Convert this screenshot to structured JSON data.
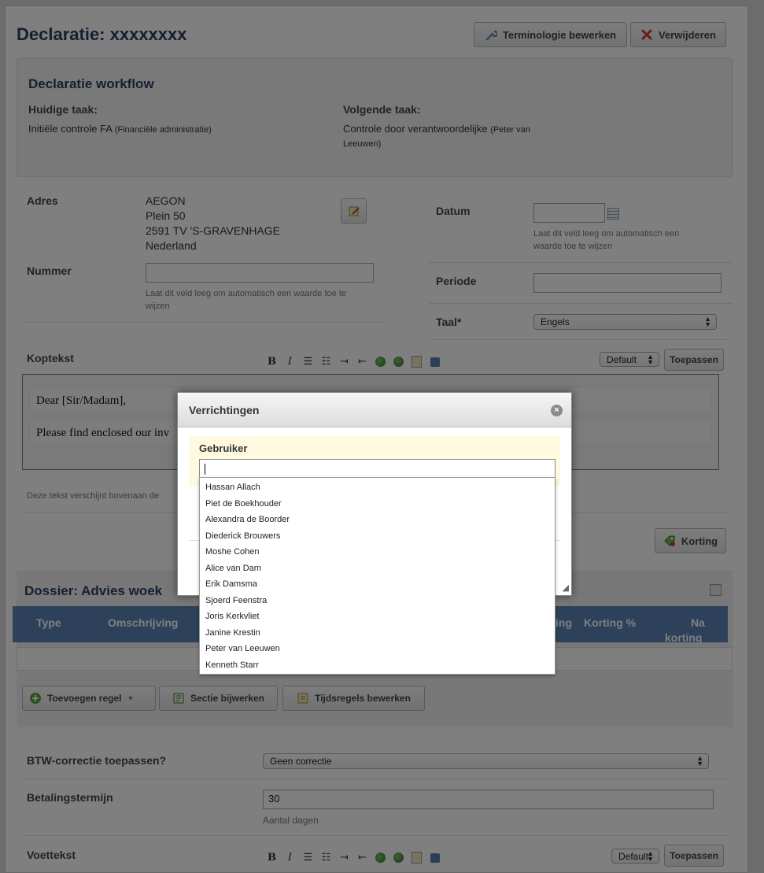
{
  "header": {
    "title": "Declaratie: xxxxxxxx",
    "terminology_button": "Terminologie bewerken",
    "delete_button": "Verwijderen"
  },
  "workflow": {
    "title": "Declaratie workflow",
    "current_task_label": "Huidige taak:",
    "current_task_value": "Initiële controle FA",
    "current_task_note": "(Financiële administratie)",
    "next_task_label": "Volgende taak:",
    "next_task_value": "Controle door verantwoordelijke",
    "next_task_note_line1": "(Peter van",
    "next_task_note_line2": "Leeuwen)"
  },
  "form": {
    "address_label": "Adres",
    "address_lines": [
      "AEGON",
      "Plein 50",
      "2591 TV 'S-GRAVENHAGE",
      "Nederland"
    ],
    "number_label": "Nummer",
    "number_value": "",
    "number_hint_line1": "Laat dit veld leeg om automatisch een waarde toe te",
    "number_hint_line2": "wijzen",
    "date_label": "Datum",
    "date_value": "",
    "date_hint_line1": "Laat dit veld leeg om automatisch een",
    "date_hint_line2": "waarde toe te wijzen",
    "period_label": "Periode",
    "period_value": "",
    "language_label": "Taal*",
    "language_value": "Engels"
  },
  "header_text": {
    "label": "Koptekst",
    "style_select": "Default",
    "apply_button": "Toepassen",
    "line1": "Dear [Sir/Madam],",
    "line2": "Please find enclosed our inv",
    "hint": "Deze tekst verschijnt bovenaan de"
  },
  "discount_button": "Korting",
  "dossier": {
    "title": "Dossier: Advies woek",
    "columns": [
      "Type",
      "Omschrijving",
      "ing",
      "Korting %",
      "Na",
      "korting"
    ],
    "add_row_button": "Toevoegen regel",
    "section_edit_button": "Sectie bijwerken",
    "time_rows_button": "Tijdsregels bewerken"
  },
  "vat": {
    "label": "BTW-correctie toepassen?",
    "value": "Geen correctie"
  },
  "payment": {
    "label": "Betalingstermijn",
    "value": "30",
    "hint": "Aantal dagen"
  },
  "footer_text": {
    "label": "Voettekst",
    "style_select": "Default",
    "apply_button": "Toepassen"
  },
  "modal": {
    "title": "Verrichtingen",
    "field_label": "Gebruiker",
    "field_value": "",
    "options": [
      "Hassan Allach",
      "Piet de Boekhouder",
      "Alexandra de Boorder",
      "Diederick Brouwers",
      "Moshe Cohen",
      "Alice van Dam",
      "Erik Damsma",
      "Sjoerd Feenstra",
      "Joris Kerkvliet",
      "Janine Krestin",
      "Peter van Leeuwen",
      "Kenneth Starr"
    ]
  },
  "colors": {
    "title": "#2c3e64",
    "table_header": "#5a83b5",
    "modal_band": "#fffadf"
  }
}
